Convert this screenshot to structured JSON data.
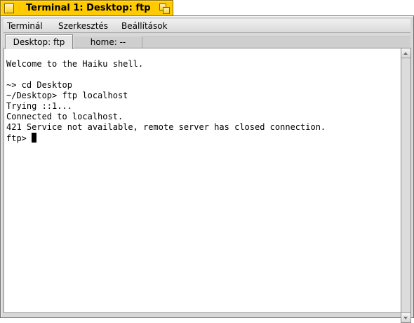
{
  "window": {
    "title": "Terminal 1: Desktop: ftp",
    "accent_color": "#ffcb00"
  },
  "menu": {
    "items": [
      "Terminál",
      "Szerkesztés",
      "Beállítások"
    ]
  },
  "tabs": [
    {
      "label": "Desktop: ftp",
      "active": true
    },
    {
      "label": "home: --",
      "active": false
    }
  ],
  "terminal": {
    "lines": [
      "",
      "Welcome to the Haiku shell.",
      "",
      "~> cd Desktop",
      "~/Desktop> ftp localhost",
      "Trying ::1...",
      "Connected to localhost.",
      "421 Service not available, remote server has closed connection.",
      "ftp> "
    ]
  },
  "icons": {
    "close": "close-icon",
    "zoom": "zoom-icon",
    "scroll_up": "arrow-up-icon",
    "scroll_down": "arrow-down-icon"
  }
}
